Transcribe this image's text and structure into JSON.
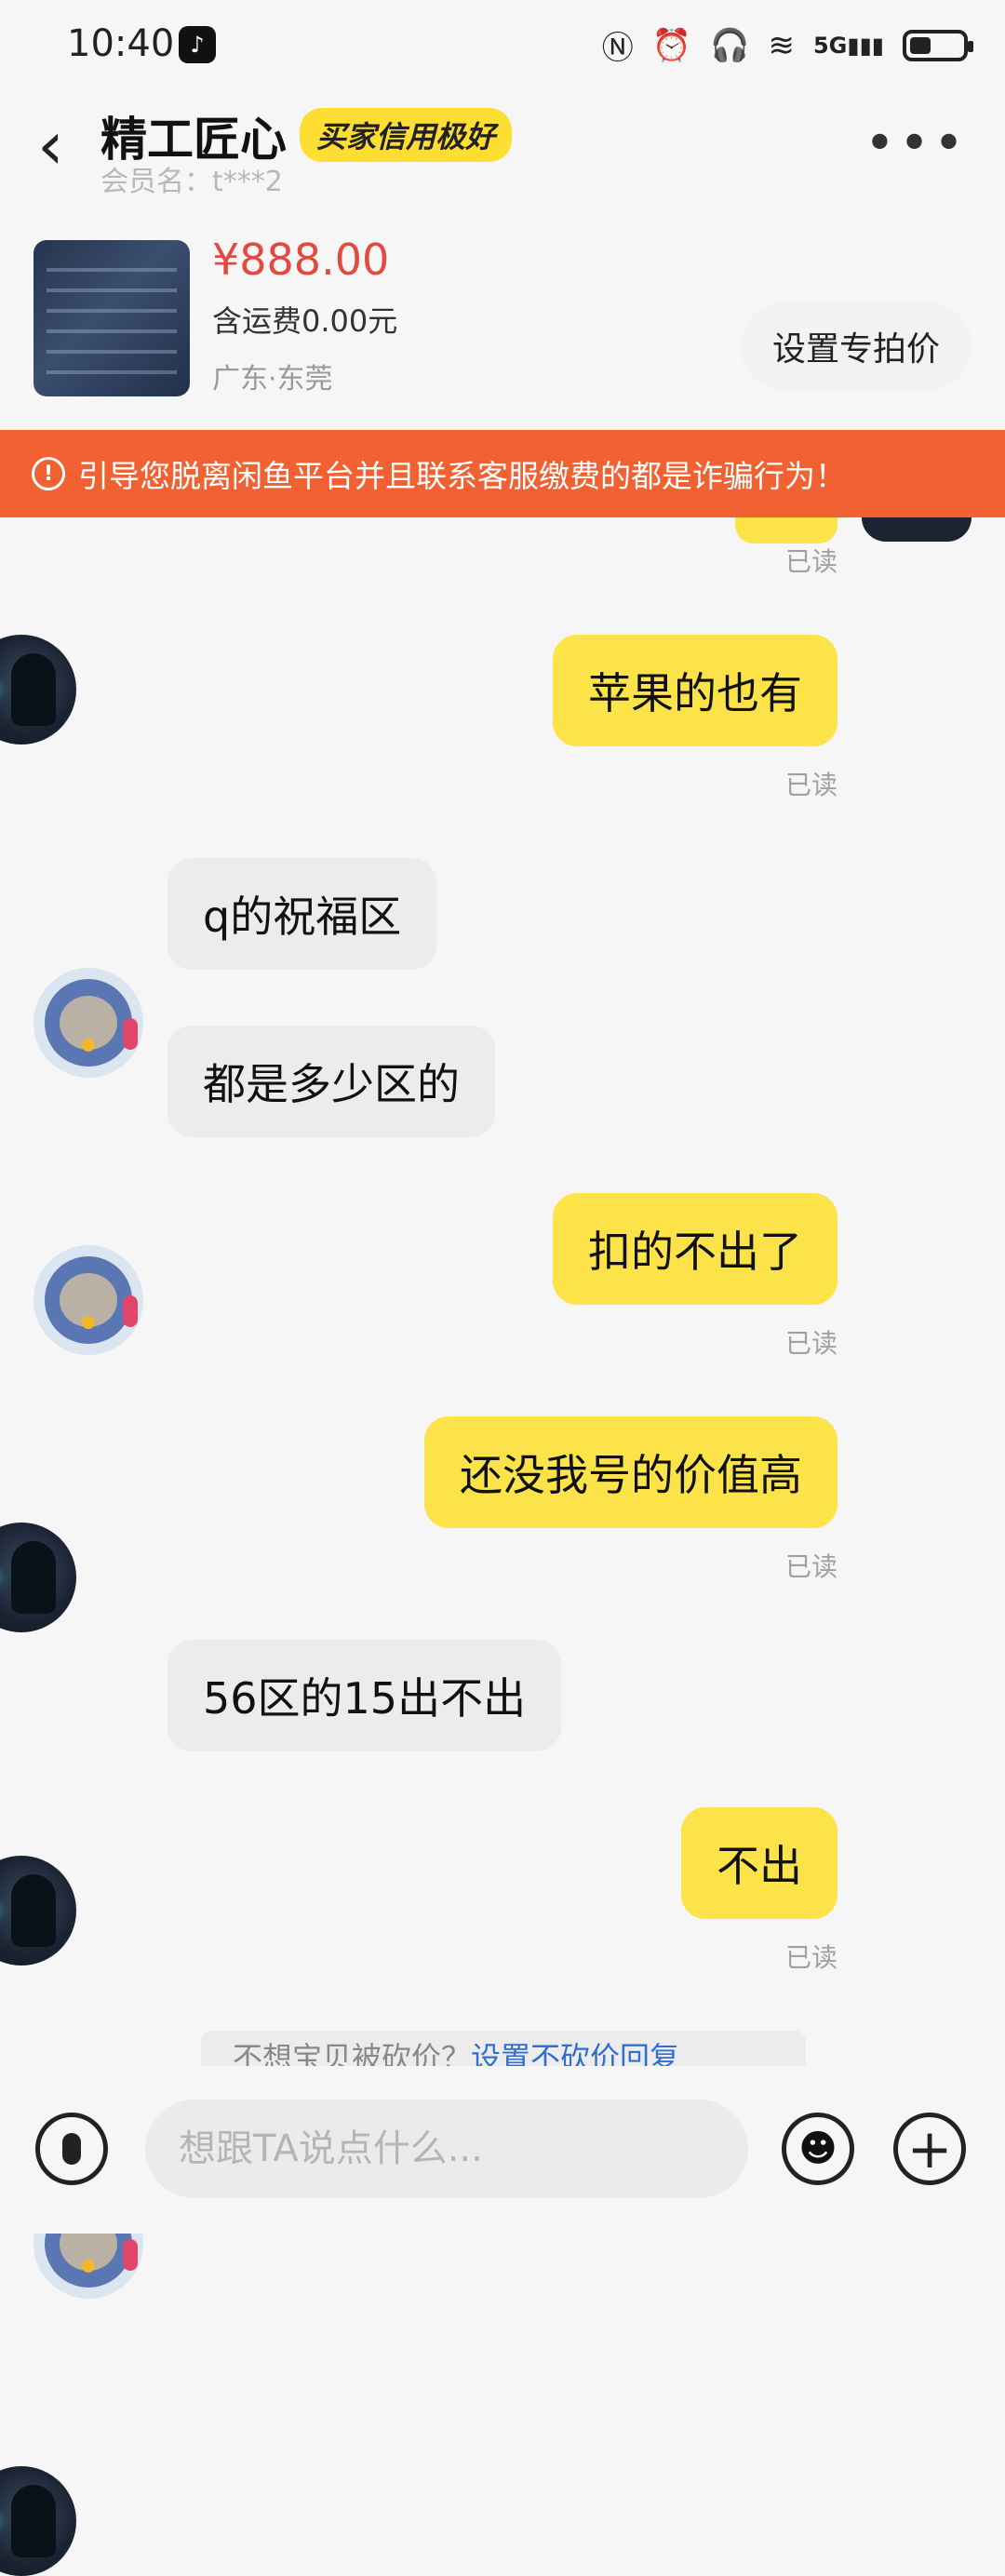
{
  "status_bar": {
    "time": "10:40",
    "icons": [
      "nfc-icon",
      "alarm-icon",
      "headphones-icon",
      "battery-small-icon",
      "wifi-icon",
      "signal-5g-icon",
      "battery-icon"
    ],
    "network_label": "5G"
  },
  "header": {
    "seller_name": "精工匠心",
    "credit_badge": "买家信用极好",
    "member_name": "会员名：t***2"
  },
  "product": {
    "price": "¥888.00",
    "shipping": "含运费0.00元",
    "location": "广东·东莞",
    "special_price_button": "设置专拍价"
  },
  "warning": {
    "text": "引导您脱离闲鱼平台并且联系客服缴费的都是诈骗行为！",
    "color": "#f16131"
  },
  "messages": [
    {
      "side": "me",
      "text": "苹果的也有",
      "status": "已读"
    },
    {
      "side": "them",
      "text": "q的祝福区"
    },
    {
      "side": "them",
      "text": "都是多少区的"
    },
    {
      "side": "me",
      "text": "扣的不出了",
      "status": "已读"
    },
    {
      "side": "me",
      "text": "还没我号的价值高",
      "status": "已读"
    },
    {
      "side": "them",
      "text": "56区的15出不出"
    },
    {
      "side": "me",
      "text": "不出",
      "status": "已读"
    }
  ],
  "top_read_status": "已读",
  "tip": {
    "text": "不想宝贝被砍价？",
    "link": "设置不砍价回复"
  },
  "input": {
    "placeholder": "想跟TA说点什么..."
  },
  "colors": {
    "my_bubble": "#fde34a",
    "their_bubble": "#ececec",
    "price": "#e34a3f",
    "badge": "#ffde34"
  }
}
